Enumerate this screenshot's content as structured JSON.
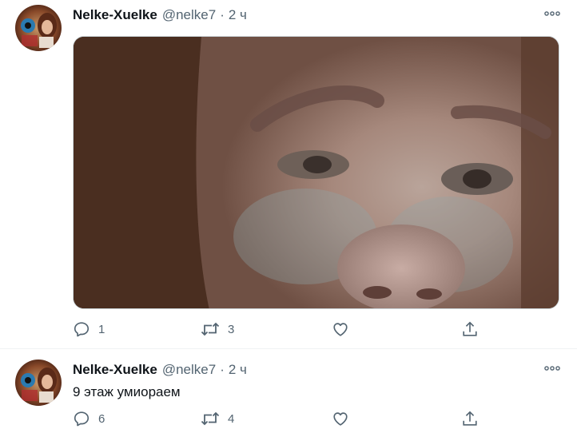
{
  "tweets": [
    {
      "display_name": "Nelke-Xuelke",
      "handle": "@nelke7",
      "separator": "·",
      "time": "2 ч",
      "text": "",
      "has_media": true,
      "replies": "1",
      "retweets": "3",
      "likes": "",
      "icons": {
        "more": "more-dots-icon",
        "reply": "reply-icon",
        "retweet": "retweet-icon",
        "like": "heart-icon",
        "share": "share-icon"
      }
    },
    {
      "display_name": "Nelke-Xuelke",
      "handle": "@nelke7",
      "separator": "·",
      "time": "2 ч",
      "text": "9 этаж умиораем",
      "has_media": false,
      "replies": "6",
      "retweets": "4",
      "likes": "",
      "icons": {
        "more": "more-dots-icon",
        "reply": "reply-icon",
        "retweet": "retweet-icon",
        "like": "heart-icon",
        "share": "share-icon"
      }
    }
  ],
  "colors": {
    "name": "#0f1419",
    "secondary": "#536471",
    "divider": "#eff3f4"
  }
}
